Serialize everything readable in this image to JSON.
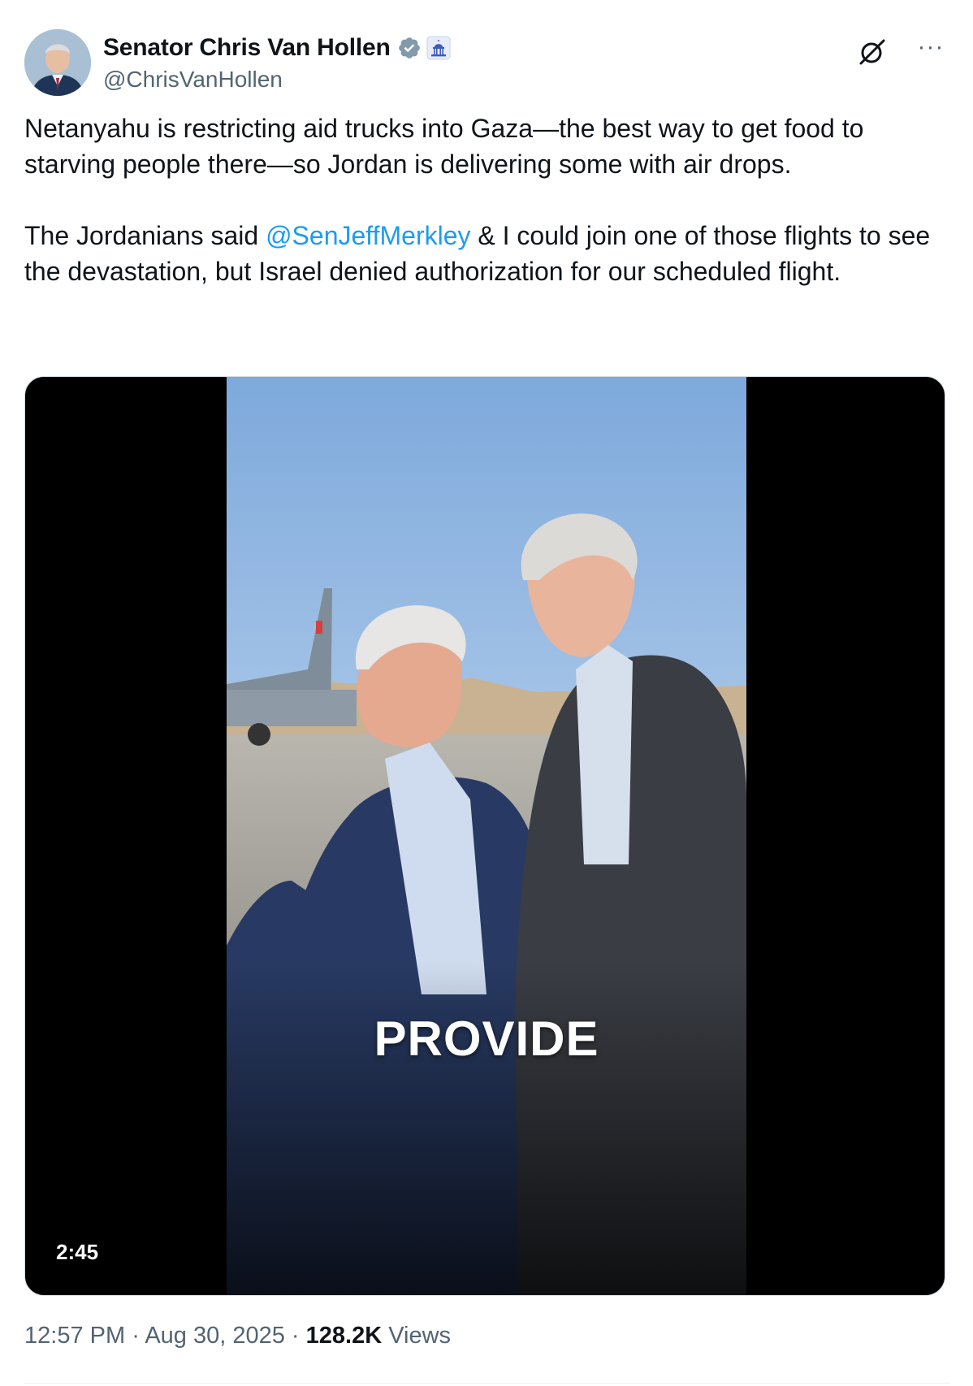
{
  "author": {
    "display_name": "Senator Chris Van Hollen",
    "handle": "@ChrisVanHollen",
    "verified_icon": "verified-badge-icon",
    "affiliation_icon": "us-capitol-icon"
  },
  "header_actions": {
    "grok_icon": "grok-icon",
    "more_label": "···"
  },
  "tweet": {
    "paragraph1": "Netanyahu is restricting aid trucks into Gaza—the best way to get food to starving people there—so Jordan is delivering some with air drops.",
    "paragraph2_before": "The Jordanians said ",
    "mention": "@SenJeffMerkley",
    "paragraph2_after": " & I could join one of those flights to see the devastation, but Israel denied authorization for our scheduled flight."
  },
  "media": {
    "caption": "PROVIDE",
    "duration": "2:45"
  },
  "meta": {
    "time": "12:57 PM",
    "separator": " · ",
    "date": "Aug 30, 2025",
    "views_count": "128.2K",
    "views_label": " Views"
  },
  "colors": {
    "link": "#1d9bf0",
    "secondary_text": "#536471",
    "verified": "#829aab"
  }
}
